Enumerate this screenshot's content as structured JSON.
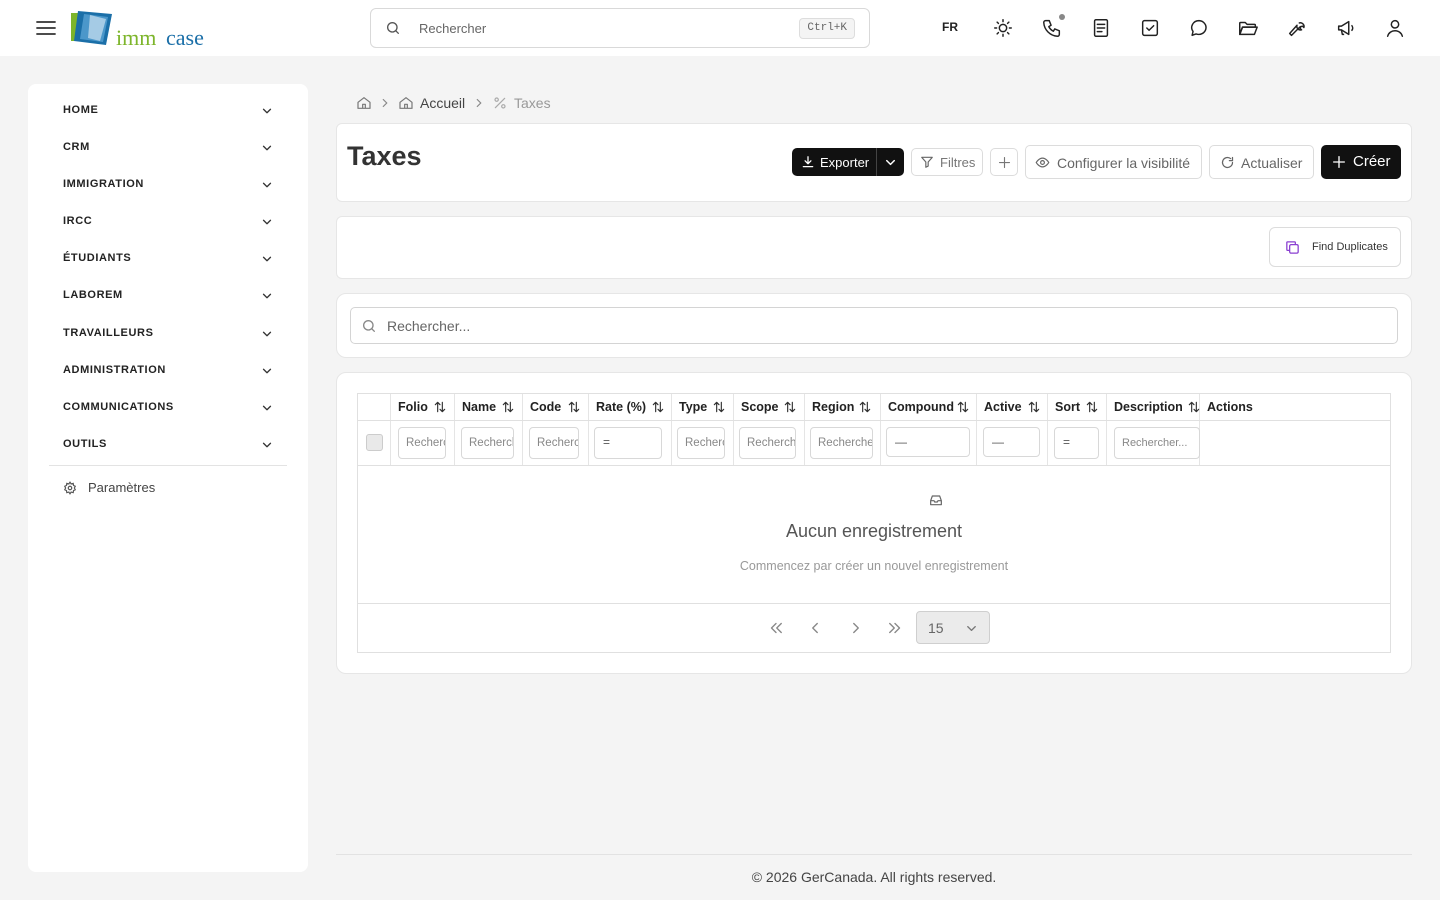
{
  "header": {
    "logo": {
      "part1": "imm",
      "part2": "case"
    },
    "search": {
      "placeholder": "Rechercher",
      "shortcut": "Ctrl+K"
    },
    "language": "FR",
    "icons": [
      "sun-icon",
      "phone-icon",
      "notes-icon",
      "tasks-icon",
      "messages-icon",
      "folder-icon",
      "tools-icon",
      "megaphone-icon",
      "user-icon"
    ]
  },
  "sidebar": {
    "items": [
      {
        "label": "HOME"
      },
      {
        "label": "CRM"
      },
      {
        "label": "IMMIGRATION"
      },
      {
        "label": "IRCC"
      },
      {
        "label": "ÉTUDIANTS"
      },
      {
        "label": "LABOREM"
      },
      {
        "label": "TRAVAILLEURS"
      },
      {
        "label": "ADMINISTRATION"
      },
      {
        "label": "COMMUNICATIONS"
      },
      {
        "label": "OUTILS"
      }
    ],
    "settings_label": "Paramètres"
  },
  "breadcrumb": {
    "home_label": "Accueil",
    "current": "Taxes"
  },
  "page": {
    "title": "Taxes",
    "actions": {
      "export": "Exporter",
      "filters": "Filtres",
      "visibility": "Configurer la visibilité",
      "refresh": "Actualiser",
      "create": "Créer"
    },
    "find_duplicates": "Find Duplicates",
    "search_placeholder": "Rechercher..."
  },
  "table": {
    "columns": [
      {
        "label": "Folio",
        "filter_type": "text",
        "filter_placeholder": "Rechercher..."
      },
      {
        "label": "Name",
        "filter_type": "text",
        "filter_placeholder": "Rechercher..."
      },
      {
        "label": "Code",
        "filter_type": "text",
        "filter_placeholder": "Rechercher..."
      },
      {
        "label": "Rate (%)",
        "filter_type": "select",
        "filter_value": "="
      },
      {
        "label": "Type",
        "filter_type": "text",
        "filter_placeholder": "Rechercher..."
      },
      {
        "label": "Scope",
        "filter_type": "text",
        "filter_placeholder": "Rechercher..."
      },
      {
        "label": "Region",
        "filter_type": "text",
        "filter_placeholder": "Rechercher..."
      },
      {
        "label": "Compound",
        "filter_type": "select",
        "filter_value": "—"
      },
      {
        "label": "Active",
        "filter_type": "select",
        "filter_value": "—"
      },
      {
        "label": "Sort",
        "filter_type": "select",
        "filter_value": "="
      },
      {
        "label": "Description",
        "filter_type": "text",
        "filter_placeholder": "Rechercher..."
      }
    ],
    "actions_label": "Actions",
    "empty_title": "Aucun enregistrement",
    "empty_subtitle": "Commencez par créer un nouvel enregistrement",
    "page_size": "15"
  },
  "footer": {
    "text": "© 2026 GerCanada. All rights reserved."
  }
}
